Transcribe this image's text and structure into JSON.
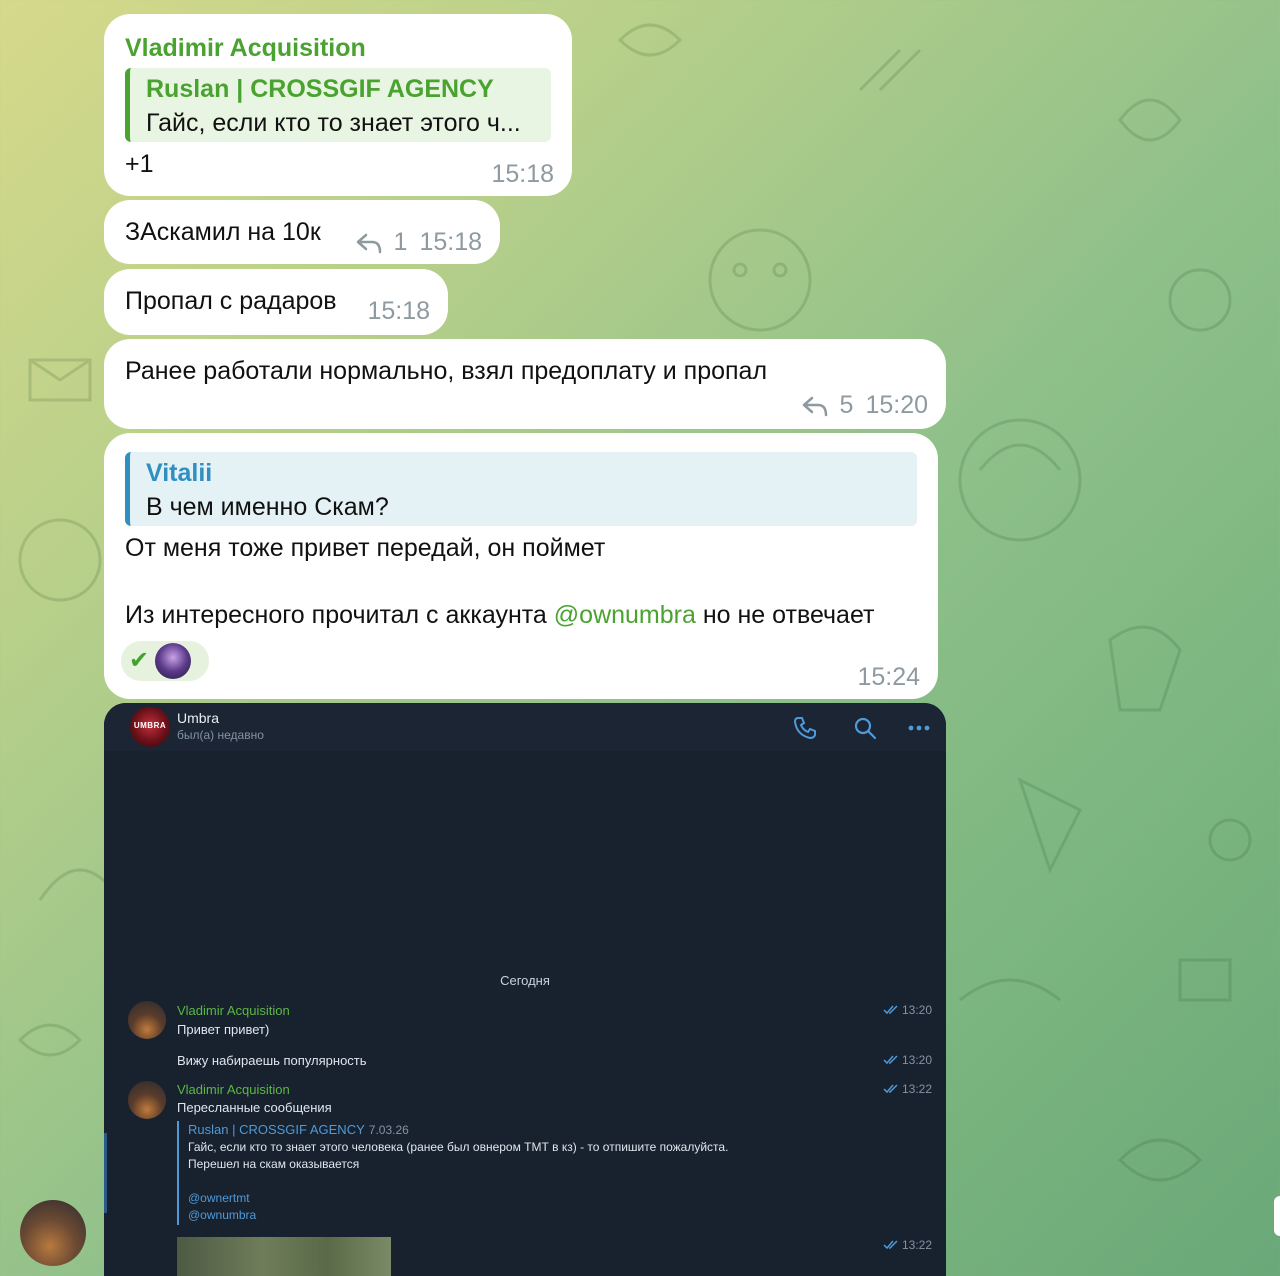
{
  "messages": {
    "m1": {
      "sender": "Vladimir Acquisition",
      "quote_name": "Ruslan | CROSSGIF AGENCY",
      "quote_text": "Гайс, если кто то знает этого ч...",
      "text": "+1",
      "time": "15:18"
    },
    "m2": {
      "text": "ЗАскамил на 10к",
      "replies": "1",
      "time": "15:18"
    },
    "m3": {
      "text": "Пропал с радаров",
      "time": "15:18"
    },
    "m4": {
      "text": "Ранее работали нормально, взял предоплату и пропал",
      "replies": "5",
      "time": "15:20"
    },
    "m5": {
      "quote_name": "Vitalii",
      "quote_text": "В чем именно Скам?",
      "line1": "От меня тоже привет передай, он поймет",
      "line2_before": "Из интересного прочитал с аккаунта ",
      "line2_mention": "@ownumbra",
      "line2_after": " но не отвечает",
      "reaction": "✅",
      "time": "15:24"
    }
  },
  "screenshot": {
    "contact_name": "Umbra",
    "contact_status": "был(а) недавно",
    "avatar_text": "UMBRA",
    "date_separator": "Сегодня",
    "msg1": {
      "sender": "Vladimir Acquisition",
      "text": "Привет привет)",
      "time": "13:20"
    },
    "msg2": {
      "text": "Вижу набираешь популярность",
      "time": "13:20"
    },
    "msg3": {
      "sender": "Vladimir Acquisition",
      "text": "Пересланные сообщения",
      "time": "13:22",
      "fwd_name": "Ruslan | CROSSGIF AGENCY",
      "fwd_date": "7.03.26",
      "fwd_line1": "Гайс, если кто то знает этого человека (ранее был овнером ТМТ в кз) - то отпишите пожалуйста.",
      "fwd_line2": "Перешел на скам оказывается",
      "fwd_link1": "@ownertmt",
      "fwd_link2": "@ownumbra"
    },
    "msg4": {
      "time": "13:22"
    }
  },
  "colors": {
    "accent_green": "#4aa231",
    "quote_blue": "#2f8fc0",
    "dark_bg": "#18212e"
  }
}
